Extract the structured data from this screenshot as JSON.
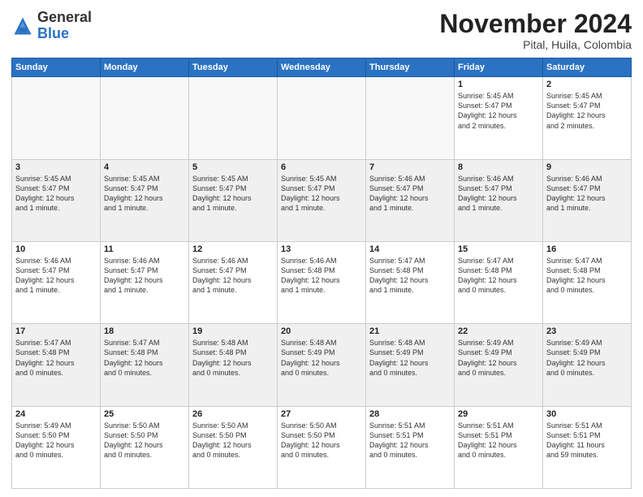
{
  "header": {
    "logo_general": "General",
    "logo_blue": "Blue",
    "month_title": "November 2024",
    "location": "Pital, Huila, Colombia"
  },
  "days_of_week": [
    "Sunday",
    "Monday",
    "Tuesday",
    "Wednesday",
    "Thursday",
    "Friday",
    "Saturday"
  ],
  "weeks": [
    {
      "shaded": false,
      "days": [
        {
          "num": "",
          "text": ""
        },
        {
          "num": "",
          "text": ""
        },
        {
          "num": "",
          "text": ""
        },
        {
          "num": "",
          "text": ""
        },
        {
          "num": "",
          "text": ""
        },
        {
          "num": "1",
          "text": "Sunrise: 5:45 AM\nSunset: 5:47 PM\nDaylight: 12 hours\nand 2 minutes."
        },
        {
          "num": "2",
          "text": "Sunrise: 5:45 AM\nSunset: 5:47 PM\nDaylight: 12 hours\nand 2 minutes."
        }
      ]
    },
    {
      "shaded": true,
      "days": [
        {
          "num": "3",
          "text": "Sunrise: 5:45 AM\nSunset: 5:47 PM\nDaylight: 12 hours\nand 1 minute."
        },
        {
          "num": "4",
          "text": "Sunrise: 5:45 AM\nSunset: 5:47 PM\nDaylight: 12 hours\nand 1 minute."
        },
        {
          "num": "5",
          "text": "Sunrise: 5:45 AM\nSunset: 5:47 PM\nDaylight: 12 hours\nand 1 minute."
        },
        {
          "num": "6",
          "text": "Sunrise: 5:45 AM\nSunset: 5:47 PM\nDaylight: 12 hours\nand 1 minute."
        },
        {
          "num": "7",
          "text": "Sunrise: 5:46 AM\nSunset: 5:47 PM\nDaylight: 12 hours\nand 1 minute."
        },
        {
          "num": "8",
          "text": "Sunrise: 5:46 AM\nSunset: 5:47 PM\nDaylight: 12 hours\nand 1 minute."
        },
        {
          "num": "9",
          "text": "Sunrise: 5:46 AM\nSunset: 5:47 PM\nDaylight: 12 hours\nand 1 minute."
        }
      ]
    },
    {
      "shaded": false,
      "days": [
        {
          "num": "10",
          "text": "Sunrise: 5:46 AM\nSunset: 5:47 PM\nDaylight: 12 hours\nand 1 minute."
        },
        {
          "num": "11",
          "text": "Sunrise: 5:46 AM\nSunset: 5:47 PM\nDaylight: 12 hours\nand 1 minute."
        },
        {
          "num": "12",
          "text": "Sunrise: 5:46 AM\nSunset: 5:47 PM\nDaylight: 12 hours\nand 1 minute."
        },
        {
          "num": "13",
          "text": "Sunrise: 5:46 AM\nSunset: 5:48 PM\nDaylight: 12 hours\nand 1 minute."
        },
        {
          "num": "14",
          "text": "Sunrise: 5:47 AM\nSunset: 5:48 PM\nDaylight: 12 hours\nand 1 minute."
        },
        {
          "num": "15",
          "text": "Sunrise: 5:47 AM\nSunset: 5:48 PM\nDaylight: 12 hours\nand 0 minutes."
        },
        {
          "num": "16",
          "text": "Sunrise: 5:47 AM\nSunset: 5:48 PM\nDaylight: 12 hours\nand 0 minutes."
        }
      ]
    },
    {
      "shaded": true,
      "days": [
        {
          "num": "17",
          "text": "Sunrise: 5:47 AM\nSunset: 5:48 PM\nDaylight: 12 hours\nand 0 minutes."
        },
        {
          "num": "18",
          "text": "Sunrise: 5:47 AM\nSunset: 5:48 PM\nDaylight: 12 hours\nand 0 minutes."
        },
        {
          "num": "19",
          "text": "Sunrise: 5:48 AM\nSunset: 5:48 PM\nDaylight: 12 hours\nand 0 minutes."
        },
        {
          "num": "20",
          "text": "Sunrise: 5:48 AM\nSunset: 5:49 PM\nDaylight: 12 hours\nand 0 minutes."
        },
        {
          "num": "21",
          "text": "Sunrise: 5:48 AM\nSunset: 5:49 PM\nDaylight: 12 hours\nand 0 minutes."
        },
        {
          "num": "22",
          "text": "Sunrise: 5:49 AM\nSunset: 5:49 PM\nDaylight: 12 hours\nand 0 minutes."
        },
        {
          "num": "23",
          "text": "Sunrise: 5:49 AM\nSunset: 5:49 PM\nDaylight: 12 hours\nand 0 minutes."
        }
      ]
    },
    {
      "shaded": false,
      "days": [
        {
          "num": "24",
          "text": "Sunrise: 5:49 AM\nSunset: 5:50 PM\nDaylight: 12 hours\nand 0 minutes."
        },
        {
          "num": "25",
          "text": "Sunrise: 5:50 AM\nSunset: 5:50 PM\nDaylight: 12 hours\nand 0 minutes."
        },
        {
          "num": "26",
          "text": "Sunrise: 5:50 AM\nSunset: 5:50 PM\nDaylight: 12 hours\nand 0 minutes."
        },
        {
          "num": "27",
          "text": "Sunrise: 5:50 AM\nSunset: 5:50 PM\nDaylight: 12 hours\nand 0 minutes."
        },
        {
          "num": "28",
          "text": "Sunrise: 5:51 AM\nSunset: 5:51 PM\nDaylight: 12 hours\nand 0 minutes."
        },
        {
          "num": "29",
          "text": "Sunrise: 5:51 AM\nSunset: 5:51 PM\nDaylight: 12 hours\nand 0 minutes."
        },
        {
          "num": "30",
          "text": "Sunrise: 5:51 AM\nSunset: 5:51 PM\nDaylight: 11 hours\nand 59 minutes."
        }
      ]
    }
  ]
}
